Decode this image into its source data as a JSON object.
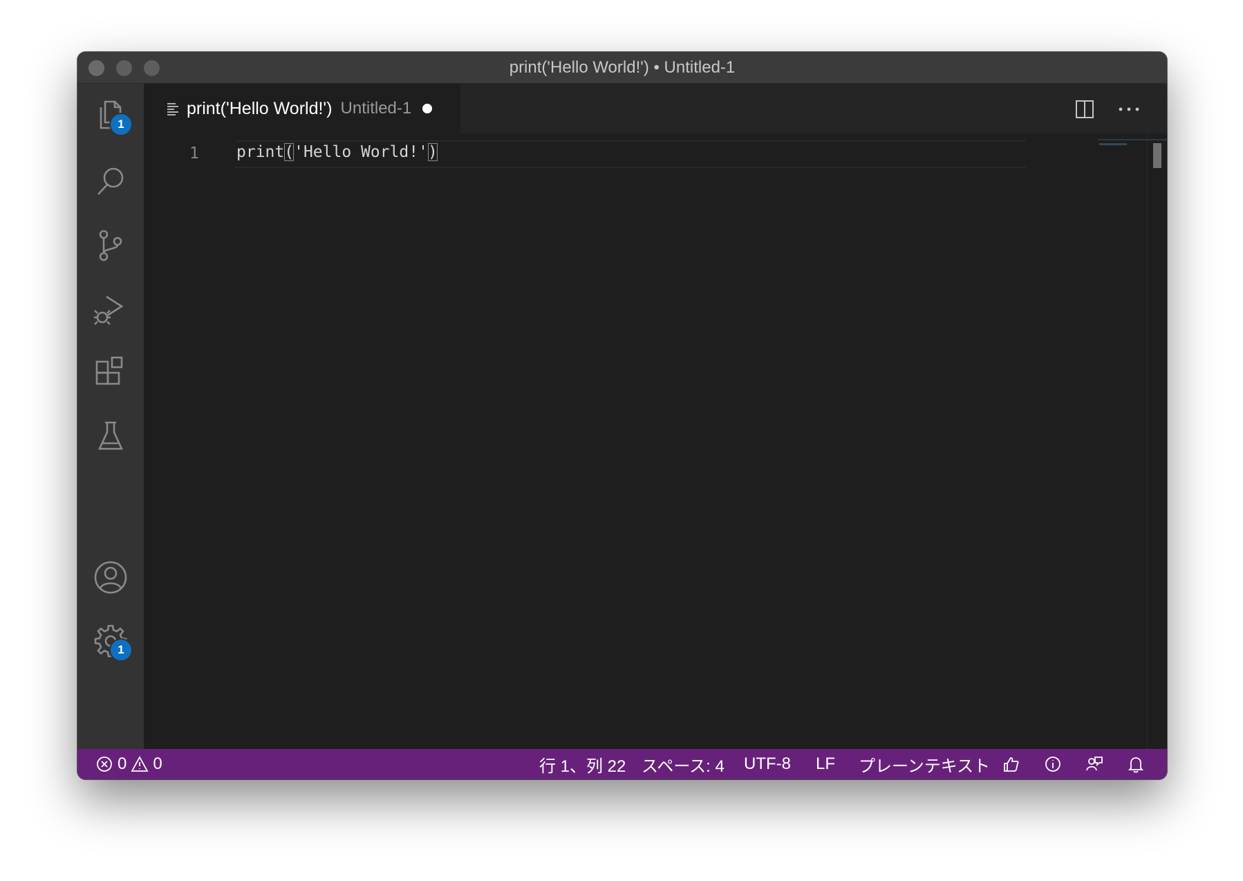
{
  "window": {
    "title": "print('Hello World!') • Untitled-1"
  },
  "activity_bar": {
    "explorer_badge": "1",
    "settings_badge": "1"
  },
  "tab": {
    "title": "print('Hello World!')",
    "description": "Untitled-1"
  },
  "editor": {
    "line_number": "1",
    "code_before": "print",
    "code_open_paren": "(",
    "code_string": "'Hello World!'",
    "code_close_paren": ")"
  },
  "status_bar": {
    "errors": "0",
    "warnings": "0",
    "cursor_position": "行 1、列 22",
    "indentation": "スペース: 4",
    "encoding": "UTF-8",
    "eol": "LF",
    "language": "プレーンテキスト"
  },
  "colors": {
    "status_bar_bg": "#68217a",
    "badge_bg": "#0e70c0",
    "editor_bg": "#1e1e1e",
    "activity_bar_bg": "#333333"
  }
}
